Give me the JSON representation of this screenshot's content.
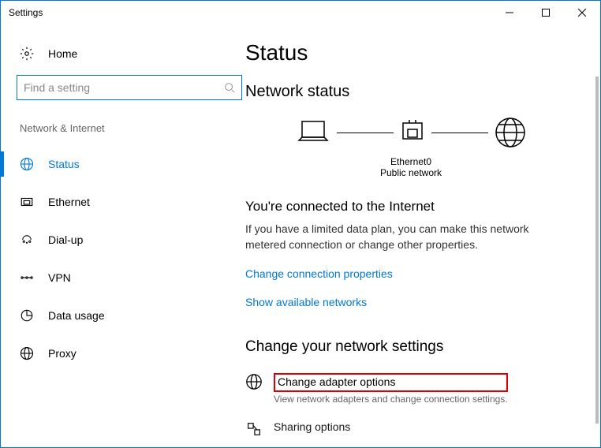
{
  "window": {
    "title": "Settings"
  },
  "sidebar": {
    "home": "Home",
    "search_placeholder": "Find a setting",
    "group": "Network & Internet",
    "items": [
      {
        "label": "Status"
      },
      {
        "label": "Ethernet"
      },
      {
        "label": "Dial-up"
      },
      {
        "label": "VPN"
      },
      {
        "label": "Data usage"
      },
      {
        "label": "Proxy"
      }
    ]
  },
  "main": {
    "title": "Status",
    "network_status": {
      "heading": "Network status",
      "adapter": "Ethernet0",
      "profile": "Public network"
    },
    "connected": {
      "heading": "You're connected to the Internet",
      "desc": "If you have a limited data plan, you can make this network metered connection or change other properties.",
      "link_props": "Change connection properties",
      "link_networks": "Show available networks"
    },
    "change_settings": {
      "heading": "Change your network settings",
      "adapter_options": {
        "label": "Change adapter options",
        "desc": "View network adapters and change connection settings."
      },
      "sharing_options": {
        "label": "Sharing options"
      }
    }
  }
}
